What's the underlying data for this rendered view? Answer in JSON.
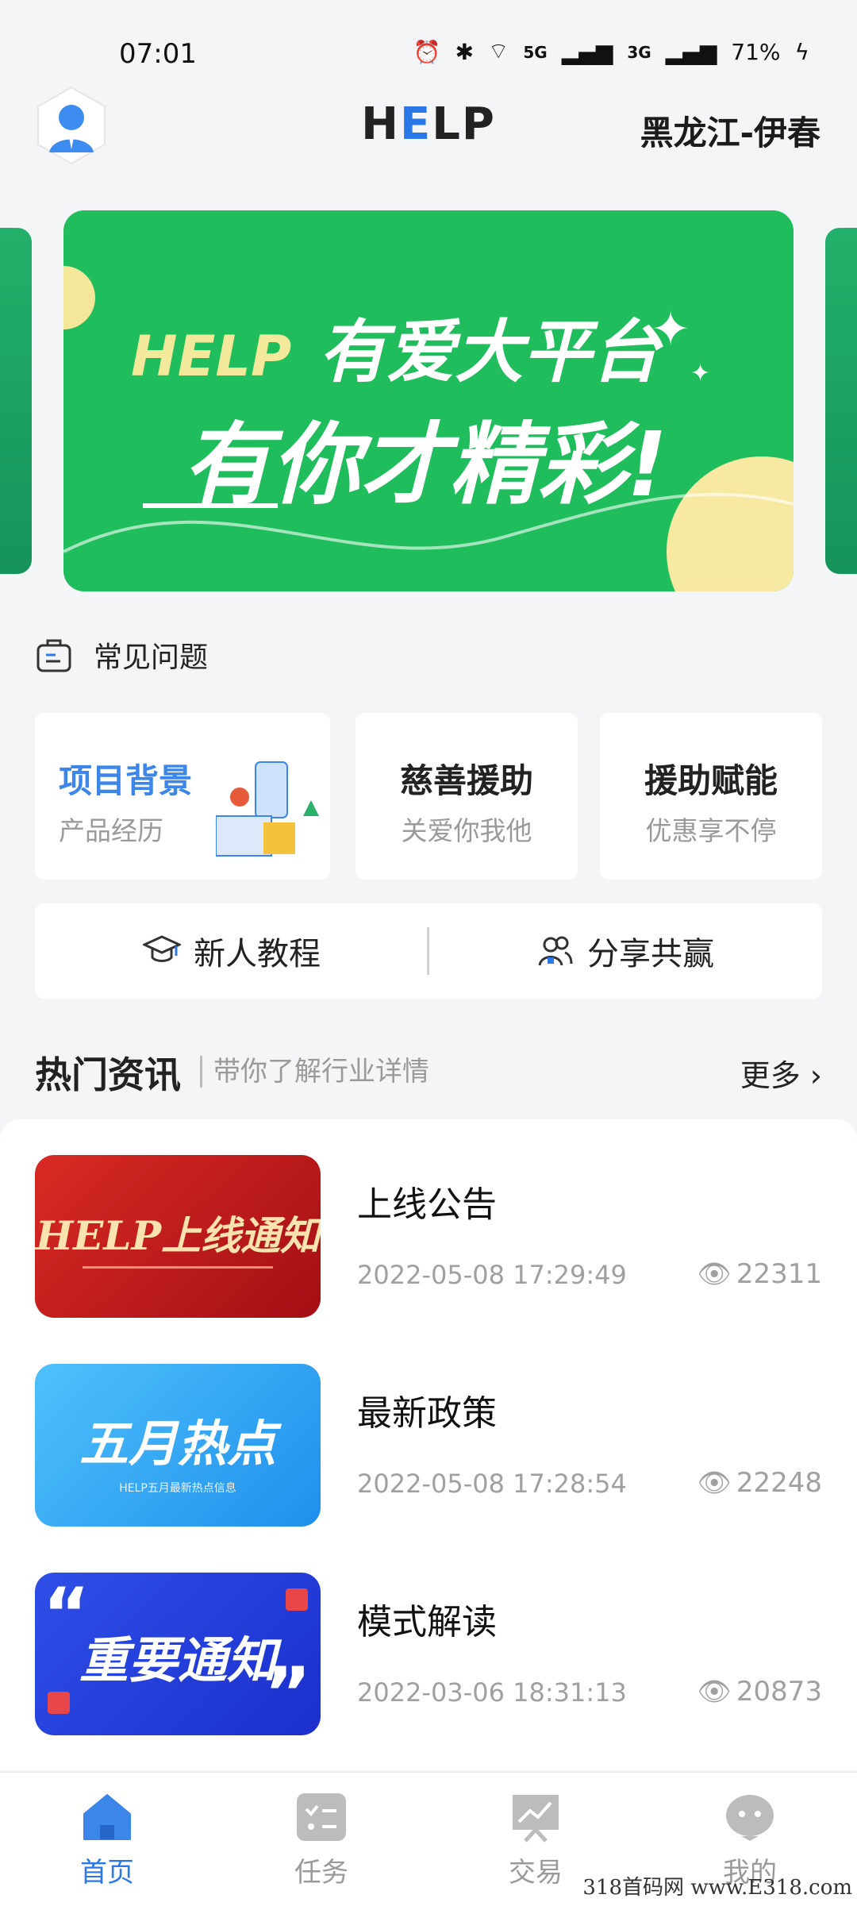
{
  "status": {
    "time": "07:01",
    "network1": "5G",
    "network2": "3G",
    "battery": "71%"
  },
  "header": {
    "logo_part1": "H",
    "logo_part2": "E",
    "logo_part3": "LP",
    "city": "黑龙江-伊春"
  },
  "banner": {
    "brand": "HELP",
    "line1": "有爱大平台",
    "line2": "有你才精彩!"
  },
  "faq": {
    "label": "常见问题"
  },
  "cards": [
    {
      "title": "项目背景",
      "subtitle": "产品经历"
    },
    {
      "title": "慈善援助",
      "subtitle": "关爱你我他"
    },
    {
      "title": "援助赋能",
      "subtitle": "优惠享不停"
    }
  ],
  "quick": {
    "tutorial": "新人教程",
    "share": "分享共赢"
  },
  "news_section": {
    "title": "热门资讯",
    "subtitle": "带你了解行业详情",
    "more": "更多"
  },
  "news": [
    {
      "title": "上线公告",
      "date": "2022-05-08 17:29:49",
      "views": "22311",
      "thumb_text": "HELP上线通知"
    },
    {
      "title": "最新政策",
      "date": "2022-05-08 17:28:54",
      "views": "22248",
      "thumb_text": "五月热点",
      "thumb_sub": "HELP五月最新热点信息"
    },
    {
      "title": "模式解读",
      "date": "2022-03-06 18:31:13",
      "views": "20873",
      "thumb_text": "重要通知"
    }
  ],
  "tabs": [
    {
      "label": "首页",
      "icon": "home-icon",
      "active": true
    },
    {
      "label": "任务",
      "icon": "task-icon",
      "active": false
    },
    {
      "label": "交易",
      "icon": "trade-icon",
      "active": false
    },
    {
      "label": "我的",
      "icon": "profile-icon",
      "active": false
    }
  ],
  "watermark": "318首码网 www.E318.com",
  "colors": {
    "accent": "#2a78e8",
    "banner_green": "#1fbd5c",
    "red": "#c81c1c",
    "blue": "#2aa2f0",
    "deep_blue": "#1b39d6"
  }
}
